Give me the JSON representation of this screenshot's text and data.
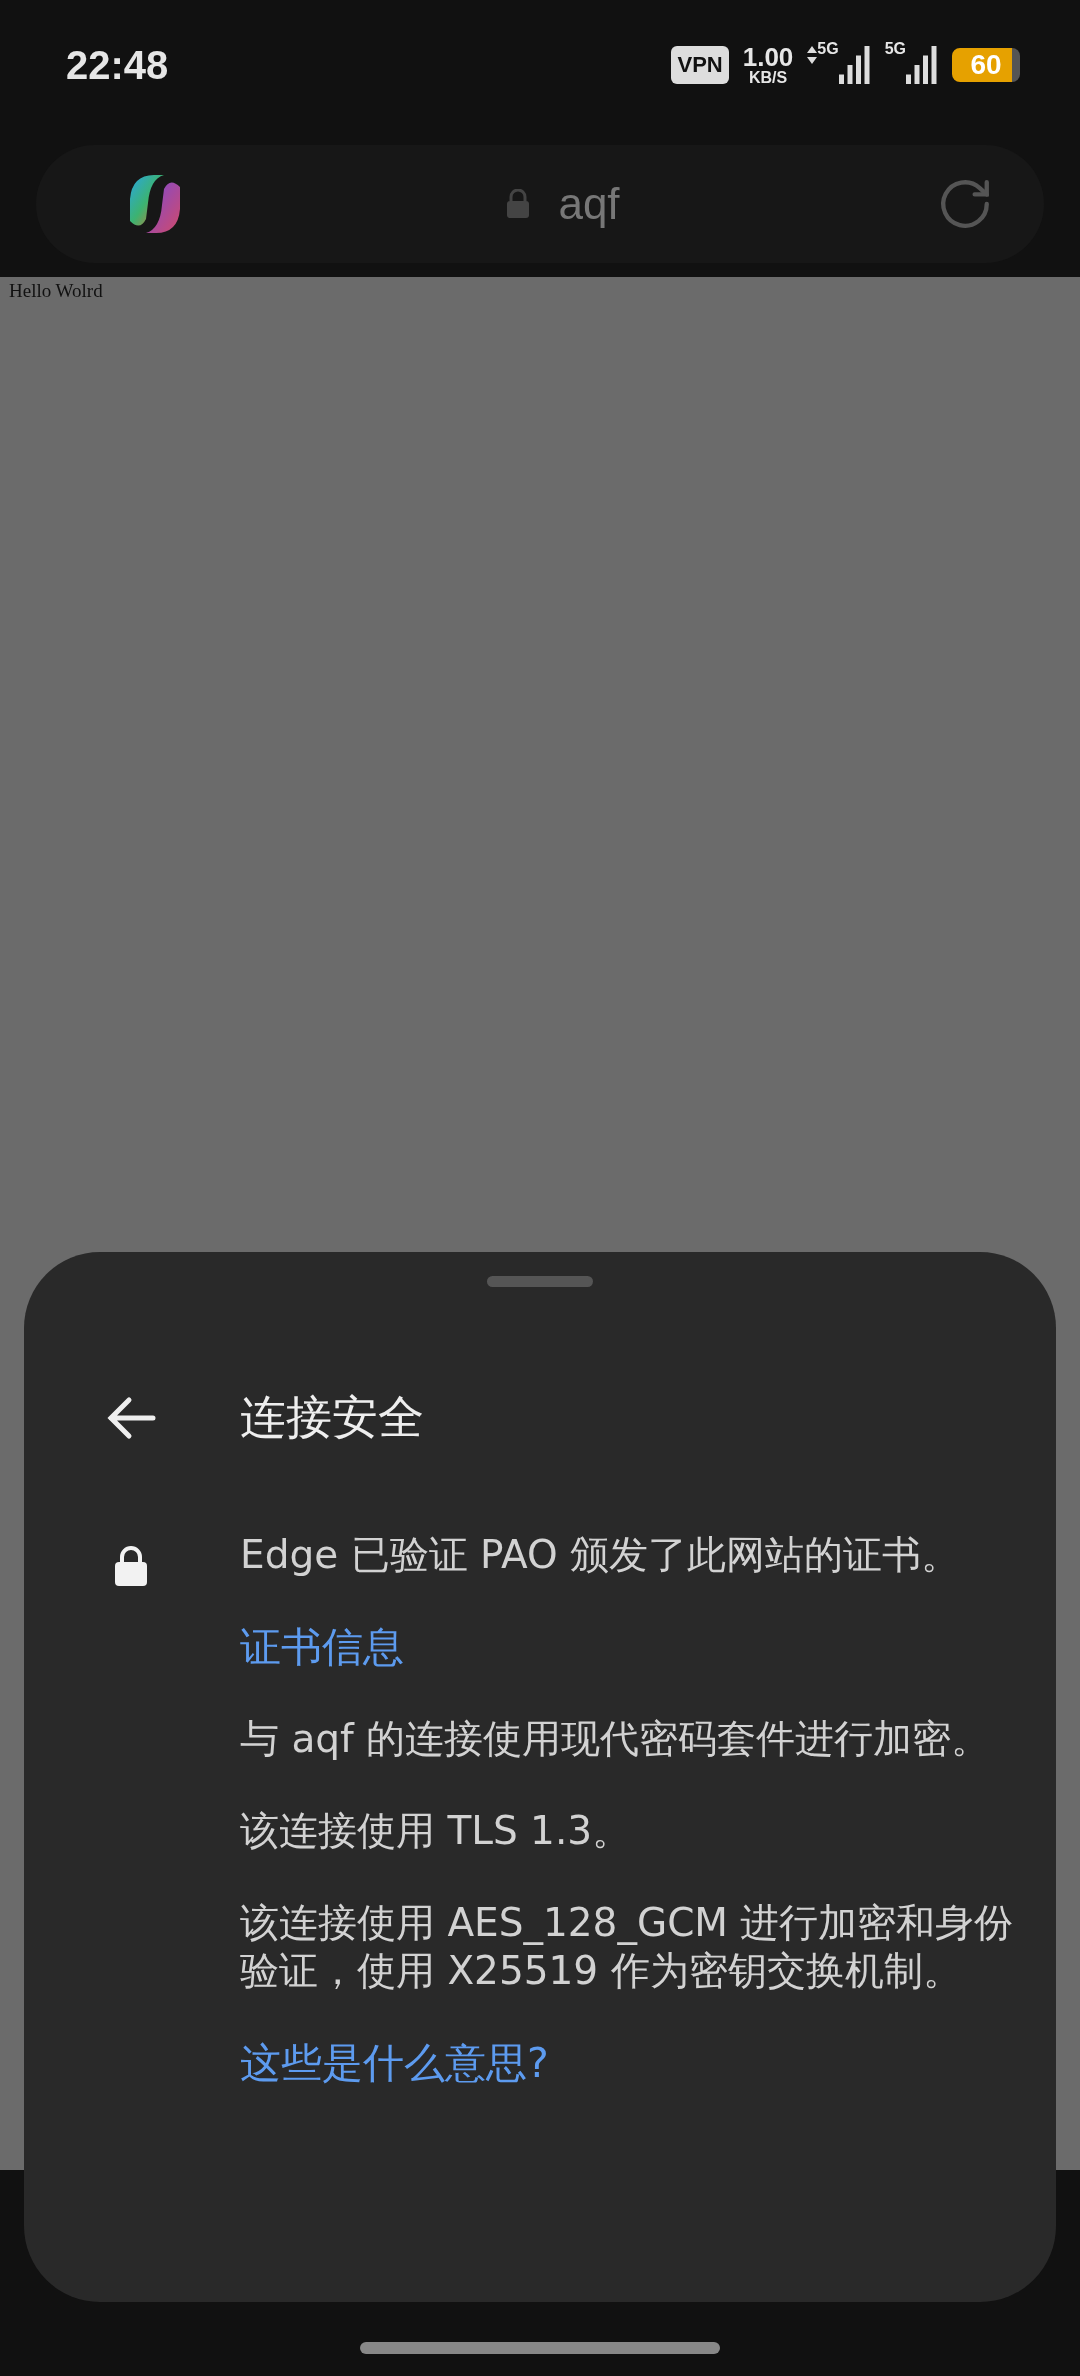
{
  "status_bar": {
    "time": "22:48",
    "vpn": "VPN",
    "speed_value": "1.00",
    "speed_unit": "KB/S",
    "network_1": "5G",
    "network_2": "5G",
    "battery": "60"
  },
  "address_bar": {
    "url": "aqf"
  },
  "page": {
    "text": "Hello Wolrd"
  },
  "sheet": {
    "title": "连接安全",
    "items": [
      {
        "kind": "text",
        "text": "Edge 已验证 PAO 颁发了此网站的证书。"
      },
      {
        "kind": "link",
        "text": "证书信息"
      },
      {
        "kind": "text",
        "text": "与 aqf 的连接使用现代密码套件进行加密。"
      },
      {
        "kind": "text",
        "text": "该连接使用 TLS 1.3。"
      },
      {
        "kind": "text",
        "text": "该连接使用 AES_128_GCM 进行加密和身份验证，使用 X25519 作为密钥交换机制。"
      },
      {
        "kind": "link",
        "text": "这些是什么意思?"
      }
    ]
  }
}
